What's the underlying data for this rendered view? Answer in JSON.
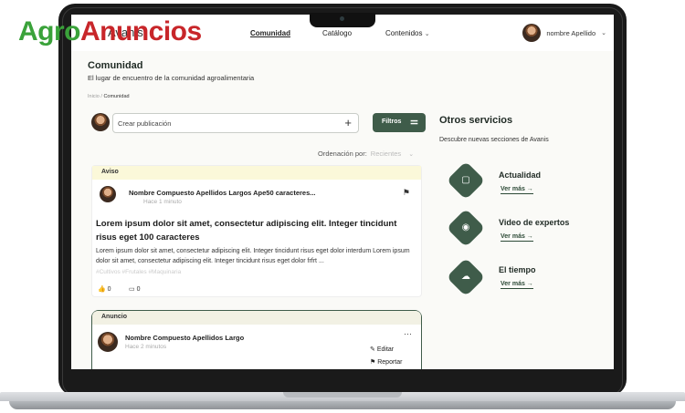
{
  "brand": {
    "part1": "Agro",
    "part2": "Anuncios"
  },
  "nav": {
    "logo": "Avanis",
    "links": [
      "Comunidad",
      "Catálogo",
      "Contenidos"
    ],
    "user": "nombre Apellido"
  },
  "page": {
    "title": "Comunidad",
    "subtitle": "El lugar de encuentro de la comunidad agroalimentaria",
    "breadcrumb_home": "Inicio /",
    "breadcrumb_current": "Comunidad"
  },
  "composer": {
    "placeholder": "Crear publicación",
    "filters_label": "Filtros"
  },
  "sort": {
    "label": "Ordenación por:",
    "value": "Recientes"
  },
  "posts": [
    {
      "tag": "Aviso",
      "author": "Nombre Compuesto Apellidos Largos Ape50 caracteres...",
      "time": "Hace 1 minuto",
      "title": "Lorem ipsum dolor sit amet, consectetur adipiscing elit. Integer tincidunt risus eget 100 caracteres",
      "body": "Lorem ipsum dolor sit amet, consectetur adipiscing elit. Integer tincidunt risus eget dolor interdum Lorem ipsum dolor sit amet, consectetur adipiscing elit. Integer tincidunt risus eget dolor frfrt ...",
      "tags": "#Cultivos #Frutales #Maquinaria",
      "likes": "0",
      "comments": "0"
    },
    {
      "tag": "Anuncio",
      "author": "Nombre Compuesto Apellidos Largo",
      "time": "Hace 2 minutos",
      "menu_edit": "Editar",
      "menu_report": "Reportar"
    }
  ],
  "sidebar": {
    "title": "Otros servicios",
    "subtitle": "Descubre nuevas secciones de Avanis",
    "services": [
      {
        "name": "Actualidad",
        "link": "Ver más →",
        "icon": "news-icon"
      },
      {
        "name": "Video de expertos",
        "link": "Ver más →",
        "icon": "camera-icon"
      },
      {
        "name": "El tiempo",
        "link": "Ver más →",
        "icon": "weather-icon"
      }
    ]
  },
  "colors": {
    "primary": "#3f5c4a",
    "brand_green": "#3aa23a",
    "brand_red": "#c8262a",
    "aviso_bg": "#fbf8d9"
  }
}
